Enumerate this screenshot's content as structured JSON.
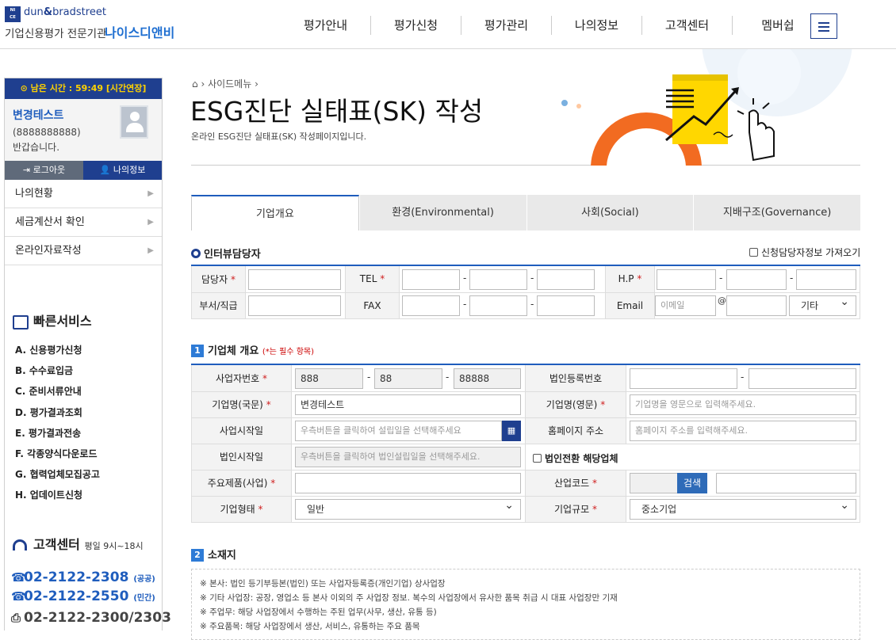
{
  "brand": {
    "mark": "NI\nCE",
    "db_a": "dun",
    "db_amp": "&",
    "db_b": "bradstreet",
    "tag1": "기업신용평가 전문기관",
    "tag2": "나이스디앤비"
  },
  "nav": [
    "평가안내",
    "평가신청",
    "평가관리",
    "나의정보",
    "고객센터",
    "멤버쉽"
  ],
  "sidebar": {
    "timer": "⊙ 남은 시간 : 59:49 [시간연장]",
    "user_name": "변경테스트",
    "user_id": "(8888888888)",
    "greeting": "반갑습니다.",
    "logout": "로그아웃",
    "myinfo": "나의정보",
    "menu": [
      "나의현황",
      "세금계산서 확인",
      "온라인자료작성"
    ],
    "quick_title": "빠른서비스",
    "quick": [
      "A. 신용평가신청",
      "B. 수수료입금",
      "C. 준비서류안내",
      "D. 평가결과조회",
      "E. 평가결과전송",
      "F. 각종양식다운로드",
      "G. 협력업체모집공고",
      "H. 업데이트신청"
    ],
    "cs_title": "고객센터",
    "cs_hours": "평일 9시~18시",
    "phones": [
      {
        "num": "02-2122-2308",
        "tag": "(공공)"
      },
      {
        "num": "02-2122-2550",
        "tag": "(민간)"
      }
    ],
    "fax": "02-2122-2300/2303"
  },
  "breadcrumb": {
    "home": "⌂",
    "item": "사이드메뉴"
  },
  "page": {
    "title": "ESG진단 실태표(SK) 작성",
    "subtitle": "온라인 ESG진단 실태표(SK) 작성페이지입니다."
  },
  "tabs": [
    "기업개요",
    "환경(Environmental)",
    "사회(Social)",
    "지배구조(Governance)"
  ],
  "interviewee": {
    "heading": "인터뷰담당자",
    "fetch_label": "신청담당자정보 가져오기",
    "labels": {
      "manager": "담당자",
      "tel": "TEL",
      "hp": "H.P",
      "dept": "부서/직급",
      "fax": "FAX",
      "email": "Email"
    },
    "email_placeholder": "이메일",
    "email_at": "@",
    "email_domain": "기타"
  },
  "company": {
    "num": "1",
    "heading": "기업체 개요",
    "note": "(*는 필수 항목)",
    "labels": {
      "bizno": "사업자번호",
      "corpno": "법인등록번호",
      "name_kr": "기업명(국문)",
      "name_en": "기업명(영문)",
      "biz_start": "사업시작일",
      "homepage": "홈페이지 주소",
      "corp_start": "법인시작일",
      "conv": "법인전환 해당업체",
      "products": "주요제품(사업)",
      "industry": "산업코드",
      "type": "기업형태",
      "scale": "기업규모"
    },
    "bizno": [
      "888",
      "88",
      "88888"
    ],
    "name_kr": "변경테스트",
    "name_en_ph": "기업명을 영문으로 입력해주세요.",
    "biz_start_ph": "우측버튼을 클릭하여 설립일을 선택해주세요",
    "homepage_ph": "홈페이지 주소를 입력해주세요.",
    "corp_start_ph": "우측버튼을 클릭하여 법인설립일을 선택해주세요.",
    "search": "검색",
    "type": "일반",
    "scale": "중소기업"
  },
  "location": {
    "num": "2",
    "heading": "소재지",
    "notes": [
      "※ 본사: 법인 등기부등본(법인) 또는 사업자등록증(개인기업) 상사업장",
      "※ 기타 사업장: 공장, 영업소 등 본사 이외의 주 사업장 정보. 복수의 사업장에서 유사한 품목 취급 시 대표 사업장만 기재",
      "※ 주업무: 해당 사업장에서 수행하는 주된 업무(사무, 생산, 유통 등)",
      "※ 주요품목: 해당 사업장에서 생산, 서비스, 유통하는 주요 품목"
    ]
  },
  "colors": {
    "brand": "#1f3f8f",
    "accent": "#1f5dbd",
    "required": "#d02020"
  }
}
